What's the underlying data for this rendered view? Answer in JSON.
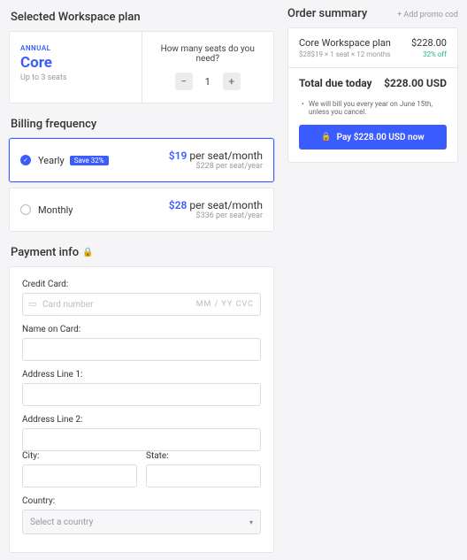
{
  "sections": {
    "plan_title": "Selected Workspace plan",
    "billing_title": "Billing frequency",
    "payment_title": "Payment info",
    "summary_title": "Order summary"
  },
  "plan": {
    "badge": "ANNUAL",
    "name": "Core",
    "sub": "Up to 3 seats",
    "seat_question": "How many seats do you need?",
    "seat_value": "1"
  },
  "billing": {
    "yearly": {
      "label": "Yearly",
      "badge": "Save 32%",
      "price": "$19",
      "unit": "per seat/month",
      "sub": "$228 per seat/year"
    },
    "monthly": {
      "label": "Monthly",
      "price": "$28",
      "unit": "per seat/month",
      "sub": "$336 per seat/year"
    }
  },
  "payment": {
    "cc_label": "Credit Card:",
    "cc_placeholder": "Card number",
    "cc_right": "MM / YY  CVC",
    "name_label": "Name on Card:",
    "addr1_label": "Address Line 1:",
    "addr2_label": "Address Line 2:",
    "city_label": "City:",
    "state_label": "State:",
    "country_label": "Country:",
    "country_placeholder": "Select a country"
  },
  "summary": {
    "promo": "+ Add promo cod",
    "item_name": "Core Workspace plan",
    "item_price": "$228.00",
    "item_detail": "$28$19 × 1 seat × 12 months",
    "discount": "32% off",
    "total_label": "Total due today",
    "total_value": "$228.00 USD",
    "fineprint": "We will bill you every year on June 15th, unless you cancel.",
    "pay_label": "Pay $228.00 USD now"
  }
}
